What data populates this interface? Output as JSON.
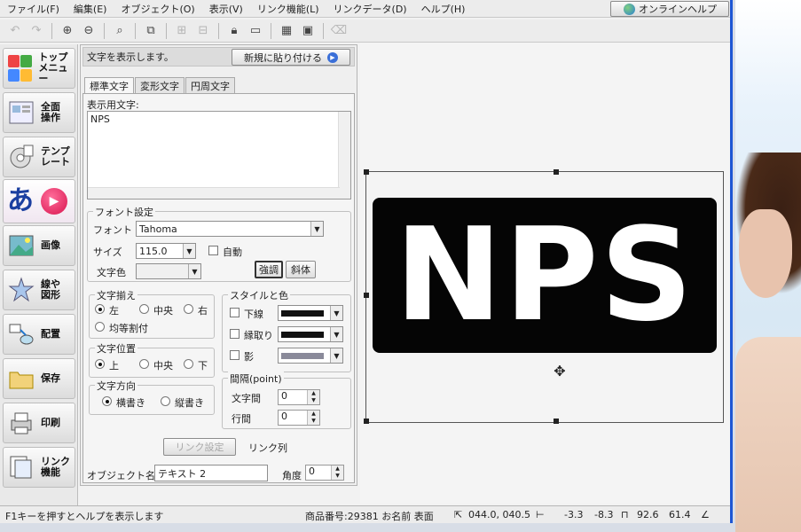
{
  "menu": [
    "ファイル(F)",
    "編集(E)",
    "オブジェクト(O)",
    "表示(V)",
    "リンク機能(L)",
    "リンクデータ(D)",
    "ヘルプ(H)"
  ],
  "help_button": "オンラインヘルプ",
  "toolbar_icons": [
    "undo-icon",
    "redo-icon",
    "zoom-in-icon",
    "zoom-out-icon",
    "zoom-fit-icon",
    "group-icon",
    "align-icon",
    "distribute-icon",
    "lock-icon",
    "unlock-icon",
    "grid-icon",
    "snap-icon",
    "clear-icon"
  ],
  "sidebar": [
    {
      "name": "home",
      "label1": "トップ",
      "label2": "メニュー"
    },
    {
      "name": "all-ops",
      "label1": "全面",
      "label2": "操作"
    },
    {
      "name": "template",
      "label1": "テンプ",
      "label2": "レート"
    },
    {
      "name": "text",
      "label1": "あ",
      "label2": ""
    },
    {
      "name": "image",
      "label1": "画像",
      "label2": ""
    },
    {
      "name": "shapes",
      "label1": "線や",
      "label2": "図形"
    },
    {
      "name": "layout",
      "label1": "配置",
      "label2": ""
    },
    {
      "name": "save",
      "label1": "保存",
      "label2": ""
    },
    {
      "name": "print",
      "label1": "印刷",
      "label2": ""
    },
    {
      "name": "link",
      "label1": "リンク",
      "label2": "機能"
    }
  ],
  "panel": {
    "header": "文字を表示します。",
    "paste_new": "新規に貼り付ける",
    "tabs": [
      "標準文字",
      "変形文字",
      "円周文字"
    ],
    "display_text_label": "表示用文字:",
    "display_text": "NPS",
    "font_group": "フォント設定",
    "font_label": "フォント",
    "font_value": "Tahoma",
    "size_label": "サイズ",
    "size_value": "115.0",
    "auto_label": "自動",
    "color_label": "文字色",
    "bold": "強調",
    "italic": "斜体",
    "align_group": "文字揃え",
    "align_left": "左",
    "align_center": "中央",
    "align_right": "右",
    "align_justify": "均等割付",
    "position_group": "文字位置",
    "pos_top": "上",
    "pos_middle": "中央",
    "pos_bottom": "下",
    "direction_group": "文字方向",
    "dir_horizontal": "横書き",
    "dir_vertical": "縦書き",
    "style_group": "スタイルと色",
    "underline": "下線",
    "outline": "縁取り",
    "shadow": "影",
    "spacing_group": "間隔(point)",
    "char_spacing": "文字間",
    "line_spacing": "行間",
    "char_spacing_value": "0",
    "line_spacing_value": "0",
    "link_settings": "リンク設定",
    "link_column": "リンク列",
    "object_name_label": "オブジェクト名",
    "object_name": "テキスト 2",
    "angle_label": "角度",
    "angle_value": "0"
  },
  "canvas": {
    "text": "NPS"
  },
  "status": {
    "hint": "F1キーを押すとヘルプを表示します",
    "product": "商品番号:29381 お名前 表面",
    "coords": "044.0, 040.5",
    "offset_x": "-3.3",
    "offset_y": "-8.3",
    "width": "92.6",
    "height": "61.4"
  },
  "colors": {
    "accent": "#1e56d4",
    "text_bg": "#050505"
  }
}
